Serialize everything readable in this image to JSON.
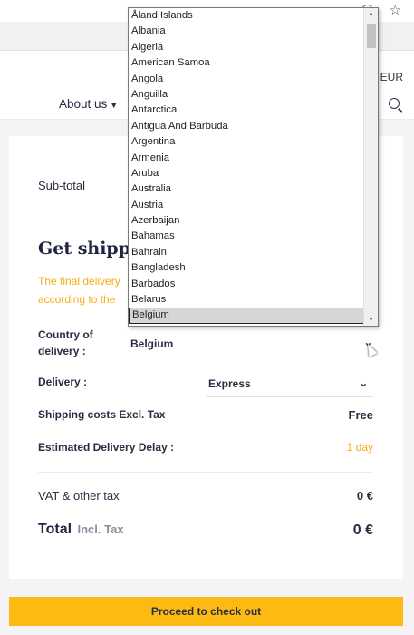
{
  "browser": {
    "icons": [
      "zoom-out-icon",
      "star-icon"
    ]
  },
  "header": {
    "currency": "EUR",
    "nav_about": "About us",
    "search_icon": "search-icon"
  },
  "cart": {
    "subtotal_label": "Sub-total",
    "shipping_title": "Get shippi",
    "shipping_note": "The final delivery according to the",
    "country_label": "Country of delivery :",
    "country_value": "Belgium",
    "delivery_label": "Delivery :",
    "delivery_value": "Express",
    "shipping_costs_label": "Shipping costs Excl. Tax",
    "shipping_costs_value": "Free",
    "eta_label": "Estimated Delivery Delay :",
    "eta_value": "1 day",
    "vat_label": "VAT & other tax",
    "vat_value": "0 €",
    "total_label": "Total",
    "total_sub": "Incl. Tax",
    "total_value": "0 €",
    "checkout_label": "Proceed to check out"
  },
  "country_dropdown": {
    "options": [
      "Åland Islands",
      "Albania",
      "Algeria",
      "American Samoa",
      "Angola",
      "Anguilla",
      "Antarctica",
      "Antigua And Barbuda",
      "Argentina",
      "Armenia",
      "Aruba",
      "Australia",
      "Austria",
      "Azerbaijan",
      "Bahamas",
      "Bahrain",
      "Bangladesh",
      "Barbados",
      "Belarus",
      "Belgium"
    ],
    "selected": "Belgium"
  },
  "colors": {
    "accent": "#fcba12",
    "note": "#f5ae16",
    "text": "#2b2d42"
  }
}
